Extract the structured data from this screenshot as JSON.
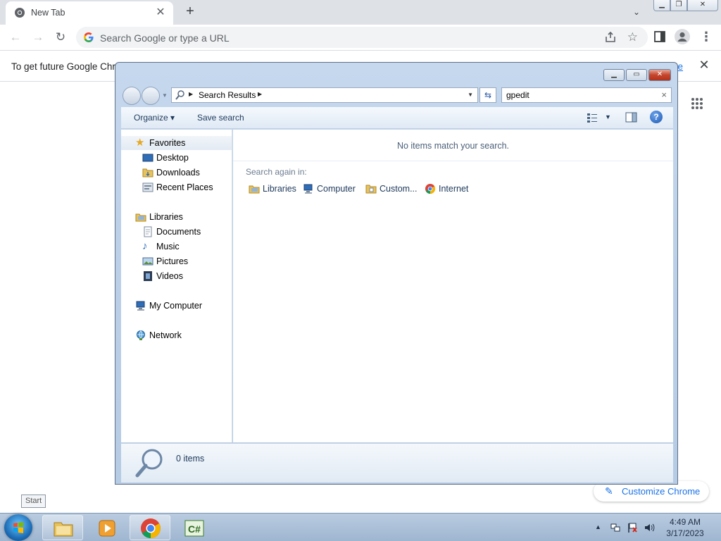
{
  "chrome": {
    "tab_title": "New Tab",
    "omnibox_placeholder": "Search Google or type a URL",
    "infobar_text": "To get future Google Chro",
    "infobar_link": "re",
    "customize_label": "Customize Chrome"
  },
  "explorer": {
    "breadcrumb": "Search Results",
    "search_query": "gpedit",
    "commands": {
      "organize": "Organize",
      "save_search": "Save search"
    },
    "nav": {
      "favorites": "Favorites",
      "desktop": "Desktop",
      "downloads": "Downloads",
      "recent_places": "Recent Places",
      "libraries": "Libraries",
      "documents": "Documents",
      "music": "Music",
      "pictures": "Pictures",
      "videos": "Videos",
      "my_computer": "My Computer",
      "network": "Network"
    },
    "content": {
      "no_items": "No items match your search.",
      "search_again": "Search again in:",
      "locations": [
        "Libraries",
        "Computer",
        "Custom...",
        "Internet"
      ]
    },
    "details": {
      "count": "0 items"
    }
  },
  "taskbar": {
    "start_tooltip": "Start",
    "time": "4:49 AM",
    "date": "3/17/2023"
  }
}
